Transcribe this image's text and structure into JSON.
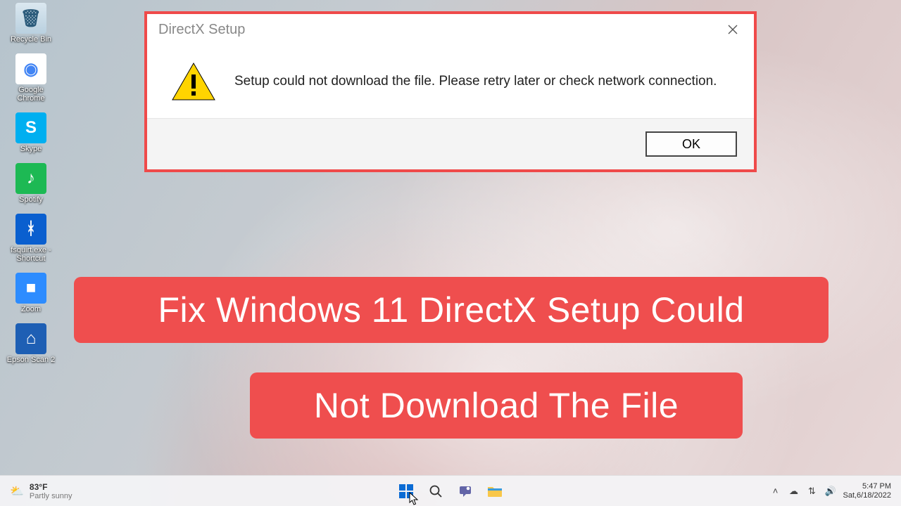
{
  "wallpaper": "windows11-bloom",
  "desktop_icons": [
    {
      "key": "recycle-bin",
      "label": "Recycle Bin",
      "bg": "linear-gradient(#dbe8f0,#b9d0df)",
      "glyph": "🗑",
      "fg": "#2a5a7a"
    },
    {
      "key": "chrome",
      "label": "Google Chrome",
      "bg": "#ffffff",
      "glyph": "◉",
      "fg": "#4285f4"
    },
    {
      "key": "skype",
      "label": "Skype",
      "bg": "#00aff0",
      "glyph": "S",
      "fg": "#ffffff"
    },
    {
      "key": "spotify",
      "label": "Spotify",
      "bg": "#1db954",
      "glyph": "♪",
      "fg": "#ffffff"
    },
    {
      "key": "bluetooth",
      "label": "fsquirt.exe - Shortcut",
      "bg": "#0a5fcf",
      "glyph": "ᚼ",
      "fg": "#ffffff"
    },
    {
      "key": "zoom",
      "label": "Zoom",
      "bg": "#2d8cff",
      "glyph": "■",
      "fg": "#ffffff"
    },
    {
      "key": "epson",
      "label": "Epson Scan 2",
      "bg": "#1e5fb4",
      "glyph": "⌂",
      "fg": "#ffffff"
    }
  ],
  "dialog": {
    "title": "DirectX Setup",
    "message": "Setup could not download the file. Please retry later or check network connection.",
    "ok": "OK"
  },
  "captions": {
    "line1": "Fix Windows 11 DirectX Setup Could",
    "line2": "Not Download The File"
  },
  "taskbar": {
    "weather": {
      "temp": "83°F",
      "condition": "Partly sunny",
      "glyph": "⛅"
    },
    "center": [
      {
        "key": "start",
        "name": "start-icon"
      },
      {
        "key": "search",
        "name": "search-icon"
      },
      {
        "key": "chat",
        "name": "chat-icon"
      },
      {
        "key": "explorer",
        "name": "file-explorer-icon"
      }
    ],
    "tray": {
      "chevron": "˄",
      "onedrive": "☁",
      "wifi": "⇅",
      "sound": "🔊"
    },
    "clock": {
      "time": "5:47 PM",
      "date": "Sat,6/18/2022"
    }
  }
}
